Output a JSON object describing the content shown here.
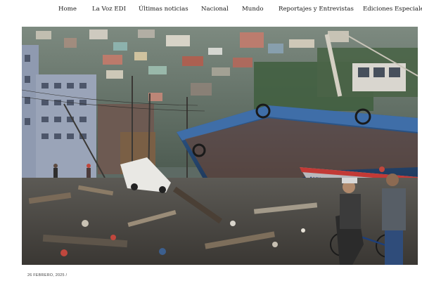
{
  "nav": {
    "items": [
      {
        "label": "Home"
      },
      {
        "label": "La Voz EDI"
      },
      {
        "label": "Últimas noticias"
      },
      {
        "label": "Nacional"
      },
      {
        "label": "Mundo"
      },
      {
        "label": "Reportajes y Entrevistas"
      },
      {
        "label": "Ediciones Especiales"
      }
    ]
  },
  "article": {
    "photo_boat_text": "AUX-DON BEVIN",
    "date": "26 FEBRERO, 2025 /"
  }
}
